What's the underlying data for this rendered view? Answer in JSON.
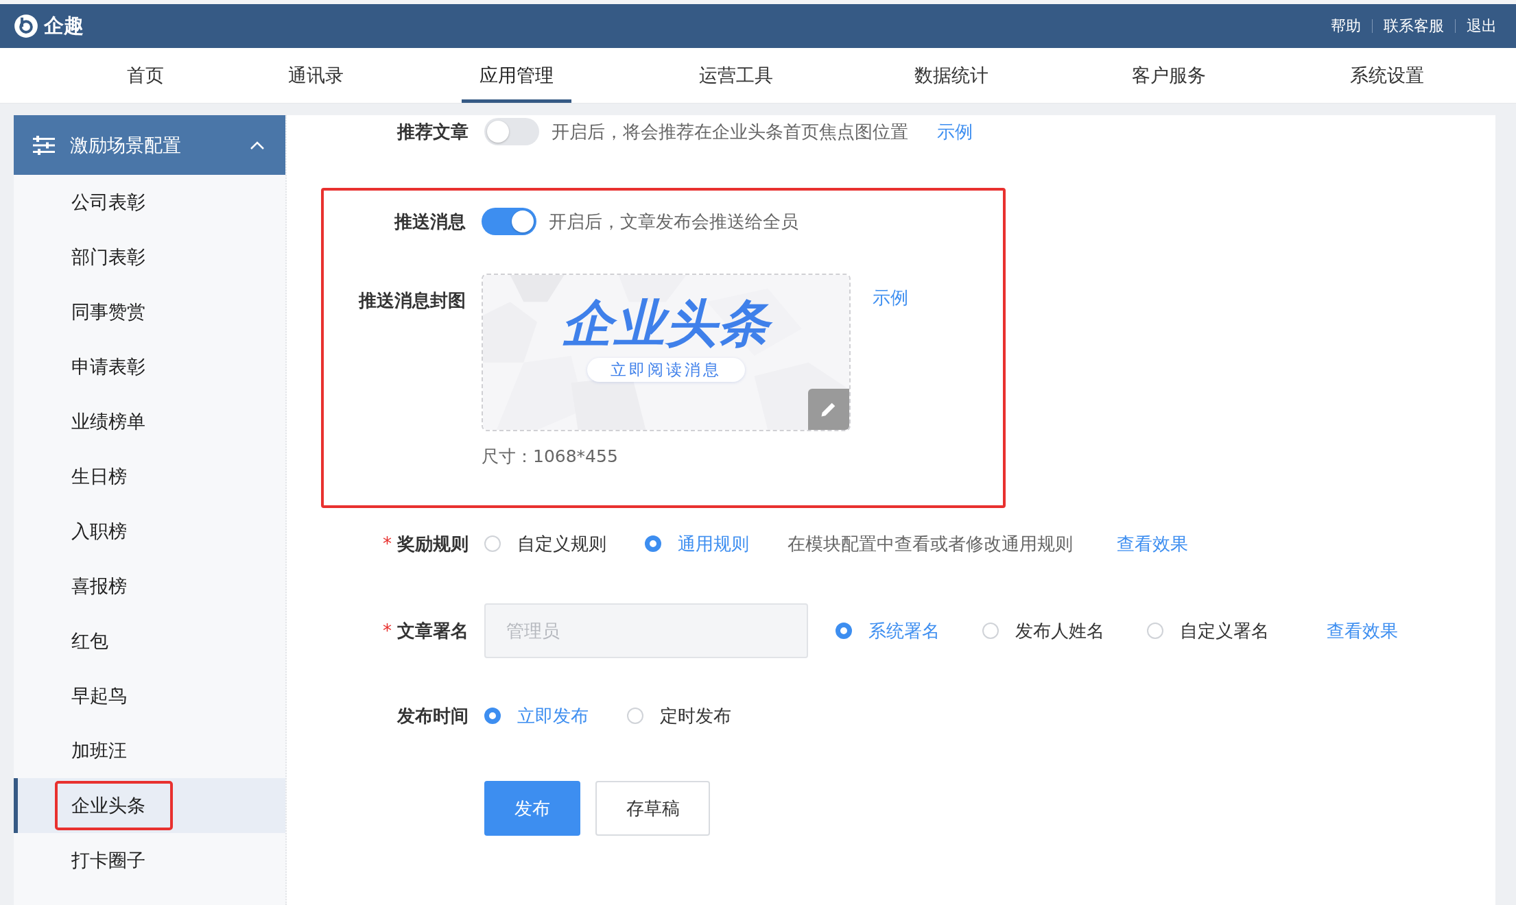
{
  "header": {
    "logo": "企趣",
    "links": [
      "帮助",
      "联系客服",
      "退出"
    ]
  },
  "nav": [
    {
      "label": "首页",
      "selected": false
    },
    {
      "label": "通讯录",
      "selected": false
    },
    {
      "label": "应用管理",
      "selected": true
    },
    {
      "label": "运营工具",
      "selected": false
    },
    {
      "label": "数据统计",
      "selected": false
    },
    {
      "label": "客户服务",
      "selected": false
    },
    {
      "label": "系统设置",
      "selected": false
    }
  ],
  "sidebar": {
    "group": {
      "title": "激励场景配置",
      "expanded": true
    },
    "items": [
      {
        "label": "公司表彰",
        "selected": false,
        "highlighted": false
      },
      {
        "label": "部门表彰",
        "selected": false,
        "highlighted": false
      },
      {
        "label": "同事赞赏",
        "selected": false,
        "highlighted": false
      },
      {
        "label": "申请表彰",
        "selected": false,
        "highlighted": false
      },
      {
        "label": "业绩榜单",
        "selected": false,
        "highlighted": false
      },
      {
        "label": "生日榜",
        "selected": false,
        "highlighted": false
      },
      {
        "label": "入职榜",
        "selected": false,
        "highlighted": false
      },
      {
        "label": "喜报榜",
        "selected": false,
        "highlighted": false
      },
      {
        "label": "红包",
        "selected": false,
        "highlighted": false
      },
      {
        "label": "早起鸟",
        "selected": false,
        "highlighted": false
      },
      {
        "label": "加班汪",
        "selected": false,
        "highlighted": false
      },
      {
        "label": "企业头条",
        "selected": true,
        "highlighted": true
      },
      {
        "label": "打卡圈子",
        "selected": false,
        "highlighted": false
      }
    ]
  },
  "form": {
    "recommend": {
      "label": "推荐文章",
      "on": false,
      "hint": "开启后，将会推荐在企业头条首页焦点图位置",
      "link": "示例"
    },
    "push_section": {
      "highlighted": true,
      "push": {
        "label": "推送消息",
        "on": true,
        "hint": "开启后，文章发布会推送给全员"
      },
      "cover": {
        "label": "推送消息封图",
        "headline": "企业头条",
        "button_text": "立即阅读消息",
        "link": "示例",
        "size_note": "尺寸：1068*455"
      }
    },
    "reward": {
      "label": "奖励规则",
      "required_mark": "*",
      "options": [
        {
          "label": "自定义规则",
          "selected": false
        },
        {
          "label": "通用规则",
          "selected": true
        }
      ],
      "hint": "在模块配置中查看或者修改通用规则",
      "link": "查看效果"
    },
    "signature": {
      "label": "文章署名",
      "required_mark": "*",
      "placeholder": "管理员",
      "options": [
        {
          "label": "系统署名",
          "selected": true
        },
        {
          "label": "发布人姓名",
          "selected": false
        },
        {
          "label": "自定义署名",
          "selected": false
        }
      ],
      "link": "查看效果"
    },
    "publish_time": {
      "label": "发布时间",
      "options": [
        {
          "label": "立即发布",
          "selected": true
        },
        {
          "label": "定时发布",
          "selected": false
        }
      ]
    },
    "actions": [
      {
        "label": "发布",
        "kind": "primary"
      },
      {
        "label": "存草稿",
        "kind": "default"
      }
    ]
  }
}
